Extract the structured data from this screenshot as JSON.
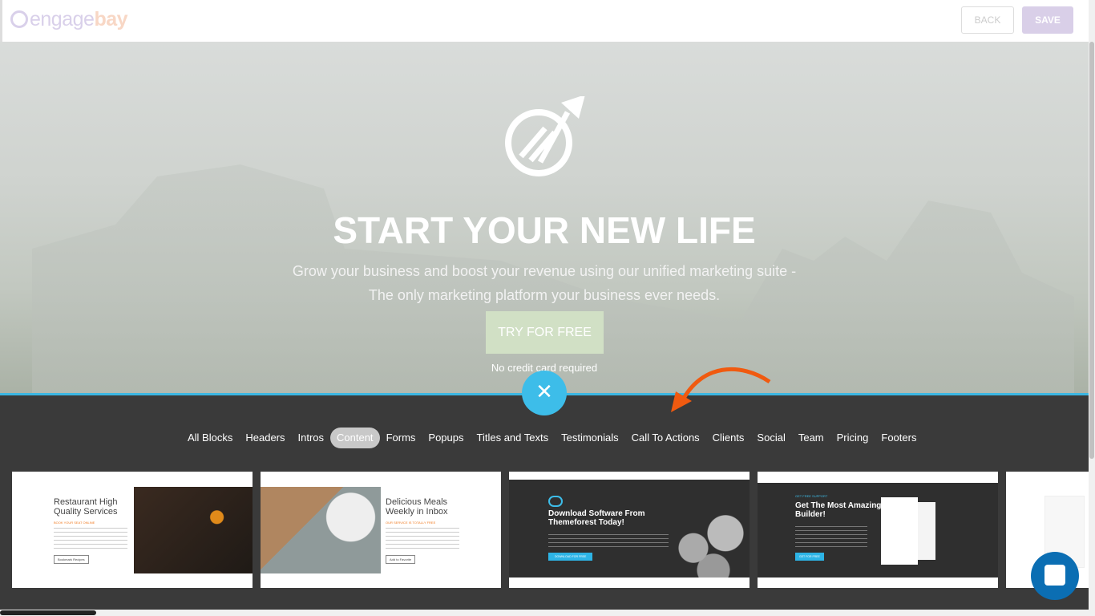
{
  "header": {
    "logo_part1": "engage",
    "logo_part2": "bay",
    "back_label": "BACK",
    "save_label": "SAVE"
  },
  "hero": {
    "title": "START YOUR NEW LIFE",
    "subtitle_line1": "Grow your business and boost your revenue using our unified marketing suite -",
    "subtitle_line2": "The only marketing platform your business ever needs.",
    "cta": "TRY FOR FREE",
    "note": "No credit card required"
  },
  "panel": {
    "close_icon": "close-icon",
    "accent": "#3dbde9",
    "annotation_arrow_color": "#f05a10"
  },
  "tabs": [
    {
      "label": "All Blocks"
    },
    {
      "label": "Headers"
    },
    {
      "label": "Intros"
    },
    {
      "label": "Content",
      "active": true
    },
    {
      "label": "Forms"
    },
    {
      "label": "Popups"
    },
    {
      "label": "Titles and Texts"
    },
    {
      "label": "Testimonials"
    },
    {
      "label": "Call To Actions"
    },
    {
      "label": "Clients"
    },
    {
      "label": "Social"
    },
    {
      "label": "Team"
    },
    {
      "label": "Pricing"
    },
    {
      "label": "Footers"
    }
  ],
  "cards": [
    {
      "title": "Restaurant High Quality Services",
      "tag": "BOOK YOUR SEAT ONLINE",
      "button": "Bookmark Recipes"
    },
    {
      "title": "Delicious Meals Weekly in Inbox",
      "tag": "OUR SERVICE IS TOTALLY FREE",
      "button": "Add to Favorite"
    },
    {
      "title": "Download Software From Themeforest Today!",
      "button": "DOWNLOAD FOR FREE"
    },
    {
      "tag": "GET FREE SUPPORT",
      "title": "Get The Most Amazing Builder!",
      "button": "GET FOR FREE"
    }
  ]
}
